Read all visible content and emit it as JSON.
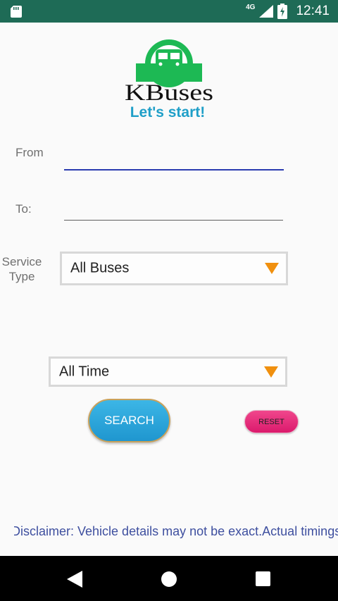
{
  "status_bar": {
    "network": "4G",
    "time": "12:41"
  },
  "logo": {
    "text": "KBuses",
    "brand_color": "#1db954"
  },
  "tagline": "Let's start!",
  "form": {
    "from_label": "From",
    "from_value": "",
    "to_label": "To:",
    "to_value": "",
    "service_type_label_line1": "Service",
    "service_type_label_line2": "Type",
    "service_type_value": "All Buses",
    "time_value": "All Time"
  },
  "buttons": {
    "search": "SEARCH",
    "reset": "RESET"
  },
  "disclaimer": "Disclaimer: Vehicle details may not be exact.Actual timings may vary",
  "colors": {
    "status_bar": "#1e6b56",
    "accent_blue": "#1f9fc8",
    "dropdown_arrow": "#f0900f",
    "reset_pink": "#e62878"
  }
}
